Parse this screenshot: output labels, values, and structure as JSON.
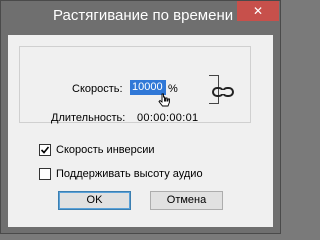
{
  "window": {
    "title": "Растягивание по времени",
    "close_glyph": "✕"
  },
  "speed": {
    "label": "Скорость:",
    "value": "10000",
    "unit": "%"
  },
  "duration": {
    "label": "Длительность:",
    "value": "00:00:00:01"
  },
  "checkboxes": [
    {
      "label": "Скорость инверсии",
      "checked": true
    },
    {
      "label": "Поддерживать высоту аудио",
      "checked": false
    }
  ],
  "buttons": {
    "ok": "OK",
    "cancel": "Отмена"
  },
  "colors": {
    "accent": "#3078d7",
    "close": "#c7504b"
  }
}
